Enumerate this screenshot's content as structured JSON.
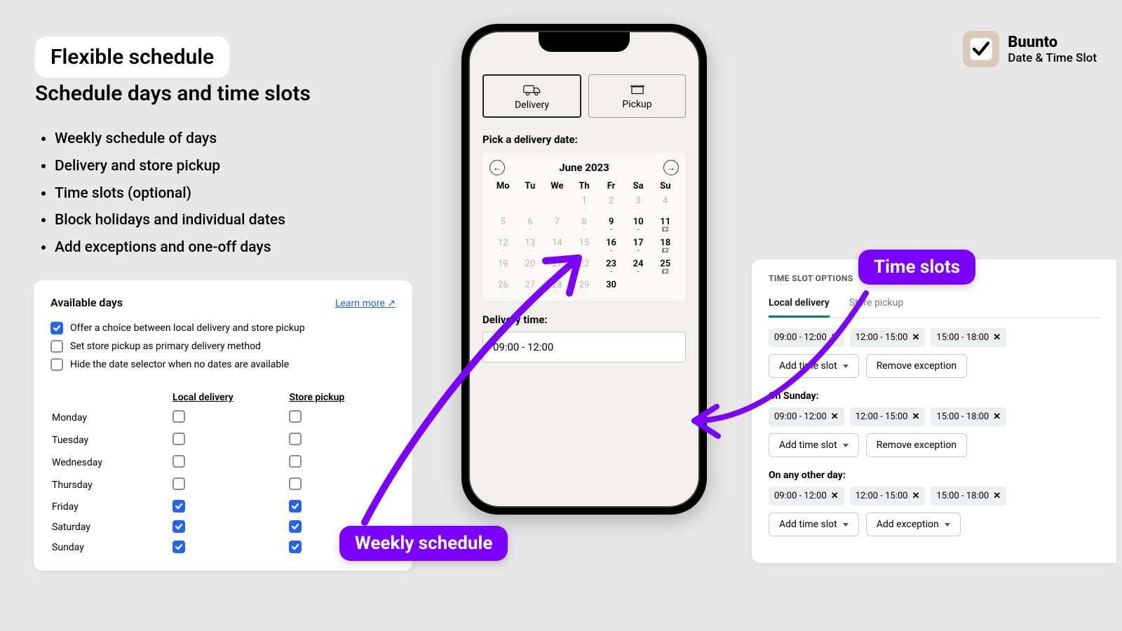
{
  "header": {
    "badge": "Flexible schedule",
    "subtitle": "Schedule days and time slots",
    "bullets": [
      "Weekly schedule of days",
      "Delivery and store pickup",
      "Time slots (optional)",
      "Block holidays and individual dates",
      "Add exceptions and one-off days"
    ]
  },
  "brand": {
    "name": "Buunto",
    "tagline": "Date & Time Slot"
  },
  "days_panel": {
    "title": "Available days",
    "learn_more": "Learn more",
    "options": [
      {
        "label": "Offer a choice between local delivery and store pickup",
        "checked": true
      },
      {
        "label": "Set store pickup as primary delivery method",
        "checked": false
      },
      {
        "label": "Hide the date selector when no dates are available",
        "checked": false
      }
    ],
    "columns": [
      "Local delivery",
      "Store pickup"
    ],
    "rows": [
      {
        "day": "Monday",
        "local": false,
        "pickup": false
      },
      {
        "day": "Tuesday",
        "local": false,
        "pickup": false
      },
      {
        "day": "Wednesday",
        "local": false,
        "pickup": false
      },
      {
        "day": "Thursday",
        "local": false,
        "pickup": false
      },
      {
        "day": "Friday",
        "local": true,
        "pickup": true
      },
      {
        "day": "Saturday",
        "local": true,
        "pickup": true
      },
      {
        "day": "Sunday",
        "local": true,
        "pickup": true
      }
    ]
  },
  "phone": {
    "methods": {
      "delivery": "Delivery",
      "pickup": "Pickup"
    },
    "pick_date_label": "Pick a delivery date:",
    "month": "June 2023",
    "dow": [
      "Mo",
      "Tu",
      "We",
      "Th",
      "Fr",
      "Sa",
      "Su"
    ],
    "weeks": [
      [
        {
          "n": "",
          "sub": ""
        },
        {
          "n": "",
          "sub": ""
        },
        {
          "n": "",
          "sub": ""
        },
        {
          "n": "1",
          "sub": "-",
          "avail": false
        },
        {
          "n": "2",
          "sub": "-",
          "avail": false
        },
        {
          "n": "3",
          "sub": "-",
          "avail": false
        },
        {
          "n": "4",
          "sub": "-",
          "avail": false
        }
      ],
      [
        {
          "n": "5",
          "sub": "-",
          "avail": false
        },
        {
          "n": "6",
          "sub": "-",
          "avail": false
        },
        {
          "n": "7",
          "sub": "-",
          "avail": false
        },
        {
          "n": "8",
          "sub": "-",
          "avail": false
        },
        {
          "n": "9",
          "sub": "-",
          "avail": true
        },
        {
          "n": "10",
          "sub": "-",
          "avail": true
        },
        {
          "n": "11",
          "sub": "£2",
          "avail": true
        }
      ],
      [
        {
          "n": "12",
          "sub": "-",
          "avail": false
        },
        {
          "n": "13",
          "sub": "-",
          "avail": false
        },
        {
          "n": "14",
          "sub": "-",
          "avail": false
        },
        {
          "n": "15",
          "sub": "-",
          "avail": false
        },
        {
          "n": "16",
          "sub": "-",
          "avail": true
        },
        {
          "n": "17",
          "sub": "-",
          "avail": true
        },
        {
          "n": "18",
          "sub": "£2",
          "avail": true
        }
      ],
      [
        {
          "n": "19",
          "sub": "-",
          "avail": false
        },
        {
          "n": "20",
          "sub": "-",
          "avail": false
        },
        {
          "n": "21",
          "sub": "-",
          "avail": false
        },
        {
          "n": "22",
          "sub": "-",
          "avail": false
        },
        {
          "n": "23",
          "sub": "-",
          "avail": true
        },
        {
          "n": "24",
          "sub": "-",
          "avail": true
        },
        {
          "n": "25",
          "sub": "£2",
          "avail": true
        }
      ],
      [
        {
          "n": "26",
          "sub": "-",
          "avail": false
        },
        {
          "n": "27",
          "sub": "-",
          "avail": false
        },
        {
          "n": "28",
          "sub": "-",
          "avail": false
        },
        {
          "n": "29",
          "sub": "-",
          "avail": false
        },
        {
          "n": "30",
          "sub": "",
          "avail": true
        },
        {
          "n": "",
          "sub": ""
        },
        {
          "n": "",
          "sub": ""
        }
      ]
    ],
    "delivery_time_label": "Delivery time:",
    "delivery_time_value": "09:00 - 12:00"
  },
  "slots_panel": {
    "heading": "TIME SLOT OPTIONS",
    "tabs": [
      "Local delivery",
      "Store pickup"
    ],
    "groups": [
      {
        "title": null,
        "chips": [
          "09:00 - 12:00",
          "12:00 - 15:00",
          "15:00 - 18:00"
        ],
        "actions": [
          "Add time slot",
          "Remove exception"
        ]
      },
      {
        "title": "On Sunday:",
        "chips": [
          "09:00 - 12:00",
          "12:00 - 15:00",
          "15:00 - 18:00"
        ],
        "actions": [
          "Add time slot",
          "Remove exception"
        ]
      },
      {
        "title": "On any other day:",
        "chips": [
          "09:00 - 12:00",
          "12:00 - 15:00",
          "15:00 - 18:00"
        ],
        "actions": [
          "Add time slot",
          "Add exception"
        ]
      }
    ]
  },
  "callouts": {
    "weekly": "Weekly schedule",
    "timeslots": "Time slots"
  }
}
